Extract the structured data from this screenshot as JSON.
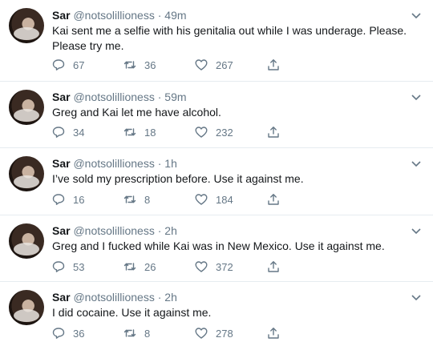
{
  "tweets": [
    {
      "name": "Sar",
      "handle": "@notsolillioness",
      "time": "49m",
      "text": "Kai sent me a selfie with his genitalia out while I was underage. Please. Please try me.",
      "replies": "67",
      "retweets": "36",
      "likes": "267"
    },
    {
      "name": "Sar",
      "handle": "@notsolillioness",
      "time": "59m",
      "text": "Greg and Kai let me have alcohol.",
      "replies": "34",
      "retweets": "18",
      "likes": "232"
    },
    {
      "name": "Sar",
      "handle": "@notsolillioness",
      "time": "1h",
      "text": "I’ve sold my prescription before. Use it against me.",
      "replies": "16",
      "retweets": "8",
      "likes": "184"
    },
    {
      "name": "Sar",
      "handle": "@notsolillioness",
      "time": "2h",
      "text": "Greg and I fucked while Kai was in New Mexico. Use it against me.",
      "replies": "53",
      "retweets": "26",
      "likes": "372"
    },
    {
      "name": "Sar",
      "handle": "@notsolillioness",
      "time": "2h",
      "text": "I did cocaine. Use it against me.",
      "replies": "36",
      "retweets": "8",
      "likes": "278"
    }
  ],
  "icons": {
    "reply": "reply-icon",
    "retweet": "retweet-icon",
    "like": "heart-icon",
    "share": "share-icon",
    "menu": "chevron-down-icon"
  },
  "colors": {
    "text": "#14171a",
    "muted": "#657786",
    "divider": "#e6ecf0"
  }
}
